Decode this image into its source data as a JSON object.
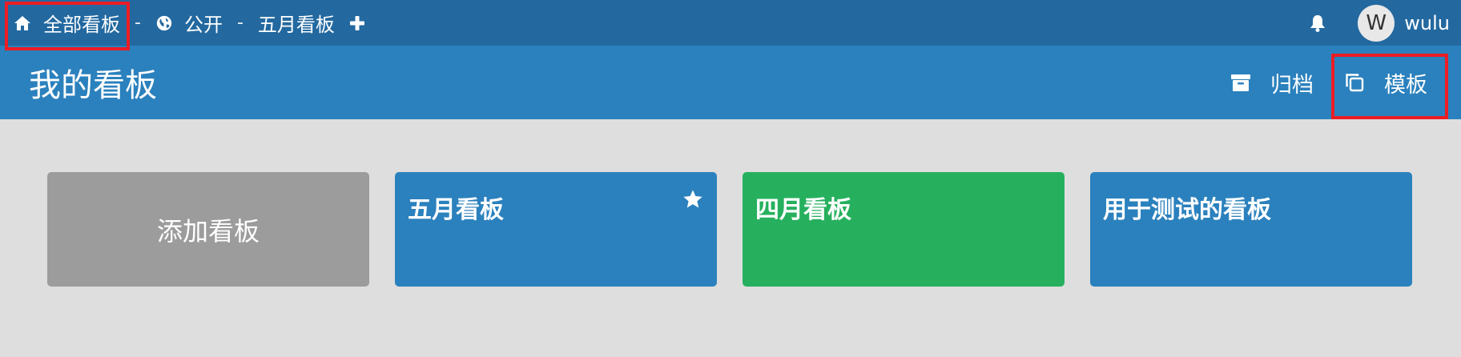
{
  "topbar": {
    "breadcrumbs": [
      {
        "label": "全部看板",
        "icon": "home-icon"
      },
      {
        "label": "公开",
        "icon": "globe-icon"
      },
      {
        "label": "五月看板"
      }
    ],
    "separator": "-",
    "add_icon": "plus-icon",
    "notifications_icon": "bell-icon",
    "user": {
      "avatar_initial": "W",
      "name": "wulu"
    }
  },
  "header": {
    "title": "我的看板",
    "actions": [
      {
        "label": "归档",
        "icon": "archive-icon"
      },
      {
        "label": "模板",
        "icon": "copy-icon"
      }
    ]
  },
  "boards": {
    "add_label": "添加看板",
    "items": [
      {
        "title": "五月看板",
        "color": "#2b81bd",
        "starred": true
      },
      {
        "title": "四月看板",
        "color": "#26b05e",
        "starred": false
      },
      {
        "title": "用于测试的看板",
        "color": "#2b81bd",
        "starred": false
      }
    ]
  },
  "colors": {
    "topbar_bg": "#2369a0",
    "header_bg": "#2b81bd",
    "page_bg": "#dedede",
    "highlight": "#ec1d24"
  }
}
